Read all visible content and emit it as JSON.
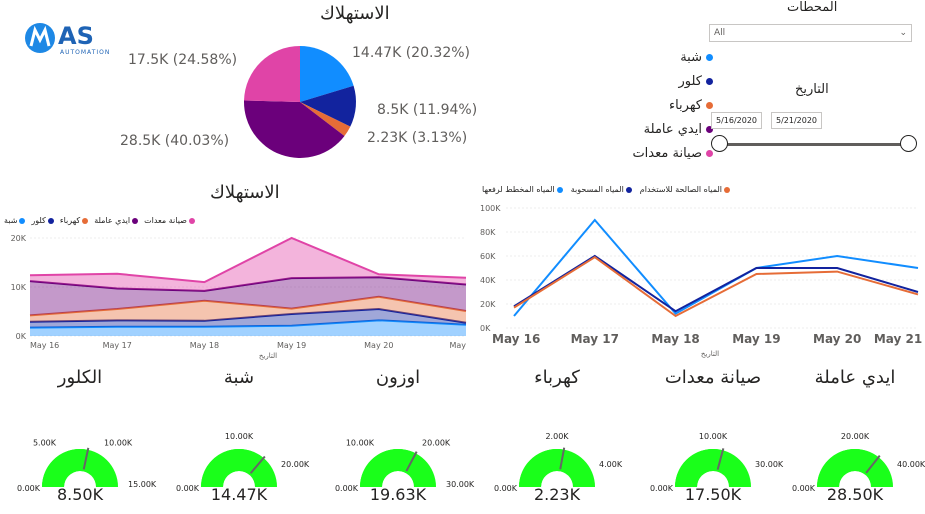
{
  "logo": {
    "text": "AS",
    "sub": "AUTOMATION"
  },
  "filters": {
    "stations_title": "المحطات",
    "stations_value": "All",
    "date_title": "التاريخ",
    "date_start": "5/16/2020",
    "date_end": "5/21/2020"
  },
  "pie": {
    "title": "الاستهلاك",
    "labels": [
      "14.47K (20.32%)",
      "8.5K (11.94%)",
      "2.23K (3.13%)",
      "28.5K (40.03%)",
      "17.5K (24.58%)"
    ],
    "legend": [
      "شبة",
      "كلور",
      "كهرباء",
      "ايدي عاملة",
      "صيانة معدات"
    ],
    "colors": [
      "#118DFF",
      "#12239E",
      "#E66C37",
      "#6B007B",
      "#E044A7"
    ]
  },
  "chart_data": [
    {
      "type": "pie",
      "title": "الاستهلاك",
      "categories": [
        "شبة",
        "كلور",
        "كهرباء",
        "ايدي عاملة",
        "صيانة معدات"
      ],
      "values": [
        14.47,
        8.5,
        2.23,
        28.5,
        17.5
      ],
      "unit": "K"
    },
    {
      "type": "area",
      "title": "الاستهلاك",
      "xlabel": "التاريخ",
      "categories": [
        "May 16",
        "May 17",
        "May 18",
        "May 19",
        "May 20",
        "May"
      ],
      "ylim": [
        0,
        20
      ],
      "yticks": [
        "0K",
        "10K",
        "20K"
      ],
      "series": [
        {
          "name": "شبة",
          "values": [
            1.7,
            1.9,
            1.9,
            2.1,
            3.2,
            2.3
          ]
        },
        {
          "name": "كلور",
          "values": [
            1.2,
            1.3,
            1.2,
            2.4,
            2.3,
            0.4
          ]
        },
        {
          "name": "كهرباء",
          "values": [
            1.3,
            2.3,
            4.1,
            1.1,
            2.5,
            2.4
          ]
        },
        {
          "name": "ايدي عاملة",
          "values": [
            7.0,
            4.2,
            2.0,
            6.2,
            4.0,
            5.4
          ]
        },
        {
          "name": "صيانة معدات",
          "values": [
            1.2,
            3.0,
            1.8,
            8.2,
            0.6,
            1.4
          ]
        }
      ]
    },
    {
      "type": "line",
      "xlabel": "التاريخ",
      "categories": [
        "May 16",
        "May 17",
        "May 18",
        "May 19",
        "May 20",
        "May 21"
      ],
      "ylim": [
        0,
        100
      ],
      "yticks": [
        "0K",
        "20K",
        "40K",
        "60K",
        "80K",
        "100K"
      ],
      "series": [
        {
          "name": "المياه المخطط لرفعها",
          "values": [
            10,
            90,
            12,
            50,
            60,
            50
          ]
        },
        {
          "name": "المياه المسحوبة",
          "values": [
            18,
            60,
            14,
            50,
            50,
            30
          ]
        },
        {
          "name": "المياه الصالحة للاستخدام",
          "values": [
            17,
            59,
            10,
            45,
            47,
            28
          ]
        }
      ]
    },
    {
      "type": "gauge",
      "items": [
        {
          "title": "الكلور",
          "value": 8.5,
          "max": 15,
          "label": "8.50K",
          "ticks": [
            "0.00K",
            "5.00K",
            "10.00K",
            "15.00K"
          ]
        },
        {
          "title": "شبة",
          "value": 14.47,
          "max": 20,
          "label": "14.47K",
          "ticks": [
            "0.00K",
            "10.00K",
            "20.00K"
          ]
        },
        {
          "title": "اوزون",
          "value": 19.63,
          "max": 30,
          "label": "19.63K",
          "ticks": [
            "0.00K",
            "10.00K",
            "20.00K",
            "30.00K"
          ]
        },
        {
          "title": "كهرباء",
          "value": 2.23,
          "max": 4,
          "label": "2.23K",
          "ticks": [
            "0.00K",
            "2.00K",
            "4.00K"
          ]
        },
        {
          "title": "صيانة معدات",
          "value": 17.5,
          "max": 30,
          "label": "17.50K",
          "ticks": [
            "0.00K",
            "10.00K",
            "30.00K"
          ]
        },
        {
          "title": "ايدي عاملة",
          "value": 28.5,
          "max": 40,
          "label": "28.50K",
          "ticks": [
            "0.00K",
            "20.00K",
            "40.00K"
          ]
        }
      ]
    }
  ],
  "area": {
    "title": "الاستهلاك",
    "legend": [
      "شبة",
      "كلور",
      "كهرباء",
      "ايدي عاملة",
      "صيانة معدات"
    ],
    "colors": [
      "#118DFF",
      "#12239E",
      "#E66C37",
      "#6B007B",
      "#E044A7"
    ],
    "xlabel": "التاريخ"
  },
  "line": {
    "legend": [
      "المياه المخطط لرفعها",
      "المياه المسحوبة",
      "المياه الصالحة للاستخدام"
    ],
    "colors": [
      "#118DFF",
      "#12239E",
      "#E66C37"
    ],
    "xlabel": "التاريخ"
  },
  "gauge_color": "#1AFF1A"
}
